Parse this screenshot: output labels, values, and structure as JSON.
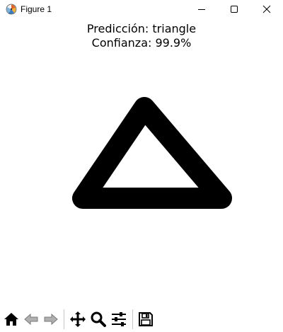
{
  "window": {
    "title": "Figure 1"
  },
  "figure": {
    "title_line1": "Predicción: triangle",
    "title_line2": "Confianza: 99.9%"
  },
  "icons": {
    "app": "matplotlib-icon",
    "minimize": "minimize-icon",
    "maximize": "maximize-icon",
    "close": "close-icon",
    "home": "home-icon",
    "back": "back-arrow-icon",
    "forward": "forward-arrow-icon",
    "pan": "pan-move-icon",
    "zoom": "zoom-magnifier-icon",
    "configure": "configure-subplots-icon",
    "save": "save-floppy-icon"
  },
  "colors": {
    "stroke": "#000000",
    "background": "#ffffff"
  }
}
